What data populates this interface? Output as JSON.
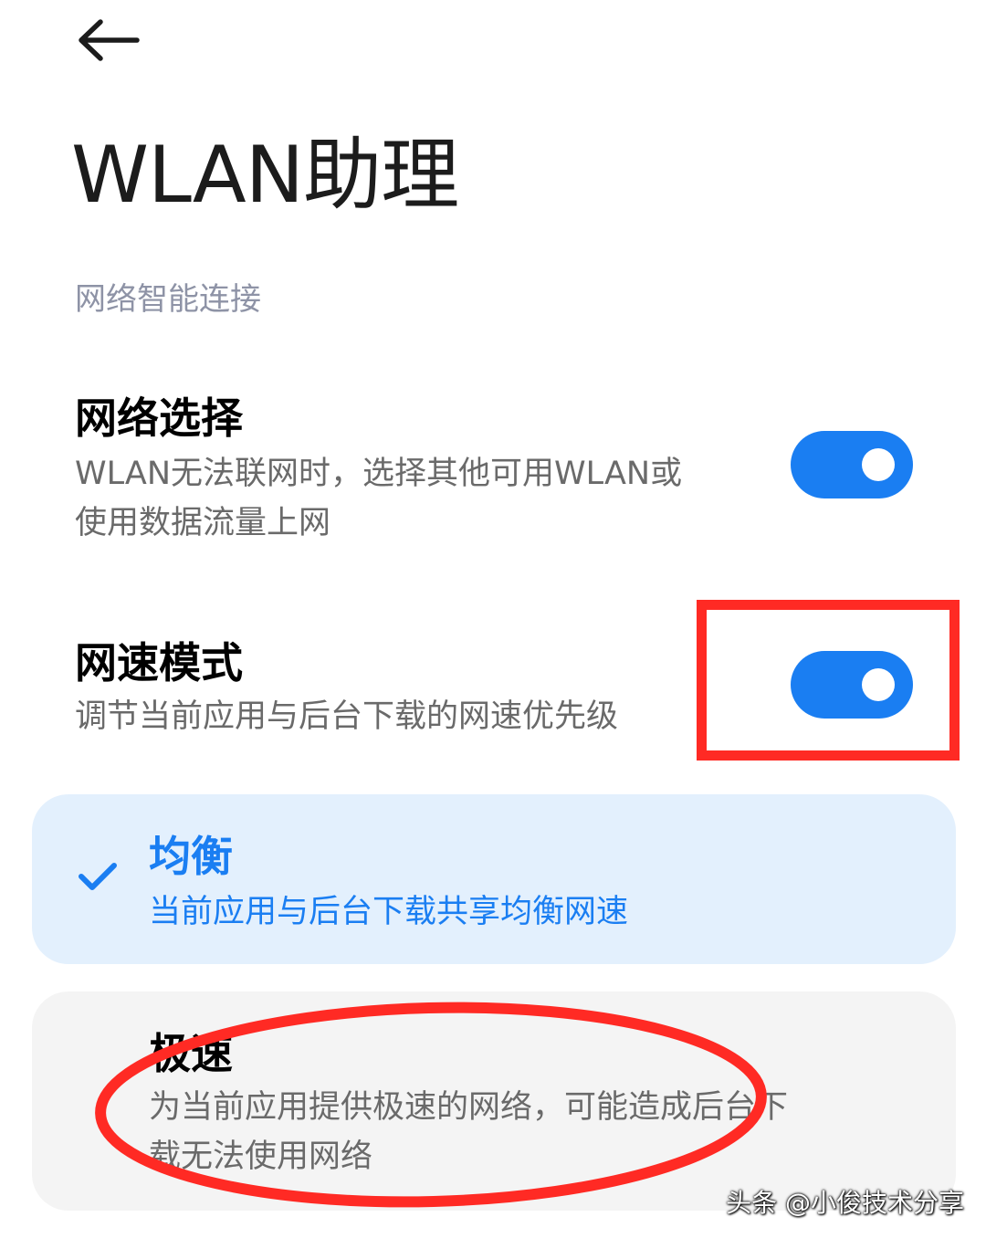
{
  "header": {
    "back_icon": "arrow-left-icon",
    "title": "WLAN助理"
  },
  "section": {
    "header": "网络智能连接"
  },
  "settings": [
    {
      "title": "网络选择",
      "desc_lines": [
        "WLAN无法联网时，选择其他可用WLAN或",
        "使用数据流量上网"
      ],
      "enabled": true
    },
    {
      "title": "网速模式",
      "desc_lines": [
        "调节当前应用与后台下载的网速优先级"
      ],
      "enabled": true
    }
  ],
  "modes": [
    {
      "title": "均衡",
      "desc_lines": [
        "当前应用与后台下载共享均衡网速"
      ],
      "selected": true,
      "icon": "check-icon"
    },
    {
      "title": "极速",
      "desc_lines": [
        "为当前应用提供极速的网络，可能造成后台下",
        "载无法使用网络"
      ],
      "selected": false
    }
  ],
  "annotations": {
    "color": "#ff2a24"
  },
  "watermark": "头条 @小俊技术分享",
  "colors": {
    "accent": "#1a7ef2",
    "section_header": "#8e93a6",
    "selected_card_bg": "#e3f0fd",
    "unselected_card_bg": "#f4f4f4"
  }
}
